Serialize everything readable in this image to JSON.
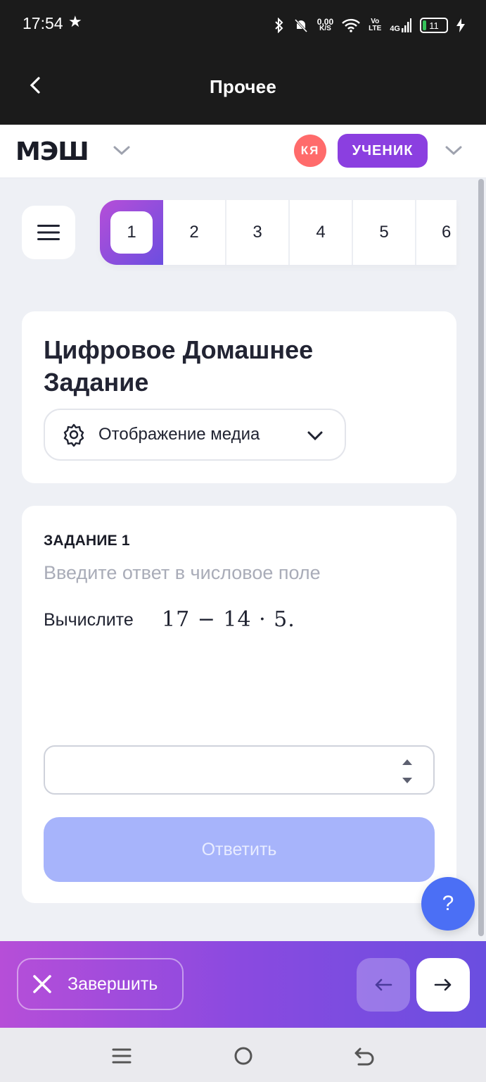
{
  "status_bar": {
    "time": "17:54",
    "net_speed_top": "0,00",
    "net_speed_bottom": "K/S",
    "volte_top": "Vo",
    "volte_bottom": "LTE",
    "network": "4G",
    "battery": "11"
  },
  "app_bar": {
    "title": "Прочее"
  },
  "header": {
    "logo": "МЭШ",
    "avatar_initials": "КЯ",
    "role": "УЧЕНИК"
  },
  "task_tabs": [
    "1",
    "2",
    "3",
    "4",
    "5",
    "6"
  ],
  "active_tab": "1",
  "card_title": "Цифровое Домашнее Задание",
  "media_button": {
    "label": "Отображение медиа"
  },
  "task": {
    "label": "ЗАДАНИЕ 1",
    "hint": "Введите ответ в числовое поле",
    "question": "Вычислите",
    "expression": "17 − 14 · 5.",
    "answer_value": "",
    "submit_label": "Ответить"
  },
  "help_label": "?",
  "footer": {
    "finish_label": "Завершить"
  },
  "colors": {
    "accent_purple": "#8b3fe0",
    "gradient_start": "#b64ed8",
    "gradient_end": "#6a4ee0",
    "submit_disabled": "#a7b4fb",
    "help_blue": "#4b6ff5",
    "avatar": "#ff6b6b"
  },
  "icons": {
    "back": "chevron-left-icon",
    "menu": "hamburger-icon",
    "settings": "gear-icon",
    "close": "close-icon",
    "prev": "arrow-left-icon",
    "next": "arrow-right-icon"
  }
}
